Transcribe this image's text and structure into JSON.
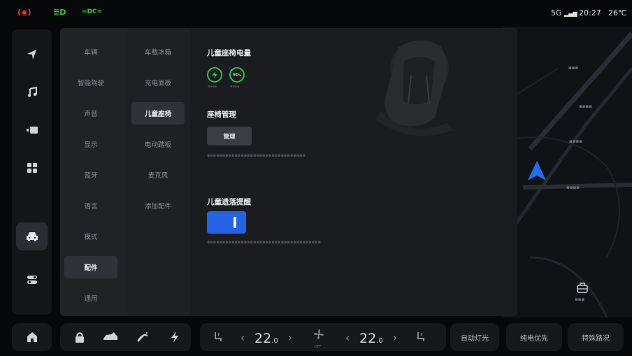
{
  "status_bar": {
    "icons": [
      "tire-pressure-warning-icon",
      "headlight-icon",
      "position-lights-icon"
    ],
    "colors": {
      "warning": "#e53935",
      "ok": "#2ecc40"
    },
    "network": "5G",
    "time": "20:27",
    "temperature": "26℃"
  },
  "rail": {
    "items": [
      {
        "icon": "navigation-icon"
      },
      {
        "icon": "music-icon"
      },
      {
        "icon": "media-icon"
      },
      {
        "icon": "apps-icon"
      },
      {
        "icon": "car-icon",
        "active": true
      },
      {
        "icon": "toggle-settings-icon"
      }
    ]
  },
  "settings": {
    "nav_primary": [
      "车辆",
      "智能驾驶",
      "声音",
      "显示",
      "蓝牙",
      "语言",
      "模式",
      "配件",
      "通用"
    ],
    "nav_primary_selected": "配件",
    "nav_secondary": [
      "车载冰箱",
      "充电面板",
      "儿童座椅",
      "电动踏板",
      "麦克风",
      "添加配件"
    ],
    "nav_secondary_selected": "儿童座椅",
    "child_seat": {
      "battery_title": "儿童座椅电量",
      "battery_1_icon": "lightning-icon",
      "battery_2_value": "90",
      "battery_2_unit": "%",
      "management_title": "座椅管理",
      "manage_button": "管理",
      "leftbehind_title": "儿童遗落提醒",
      "leftbehind_enabled": true,
      "accent": "#2563e6",
      "battery_ring": "#27c24c"
    }
  },
  "map": {
    "compass": "north-arrow-icon",
    "parking_icon": "parking-icon"
  },
  "bottom_bar": {
    "home_icon": "home-icon",
    "vehicle_controls": [
      "lock-icon",
      "trunk-icon",
      "wiper-icon",
      "charge-port-icon"
    ],
    "left_temp": "22",
    "left_temp_decimal": ".0",
    "right_temp": "22",
    "right_temp_decimal": ".0",
    "fan_label": "OFF",
    "quick_buttons": [
      "自动灯光",
      "纯电优先",
      "特殊路况"
    ]
  }
}
